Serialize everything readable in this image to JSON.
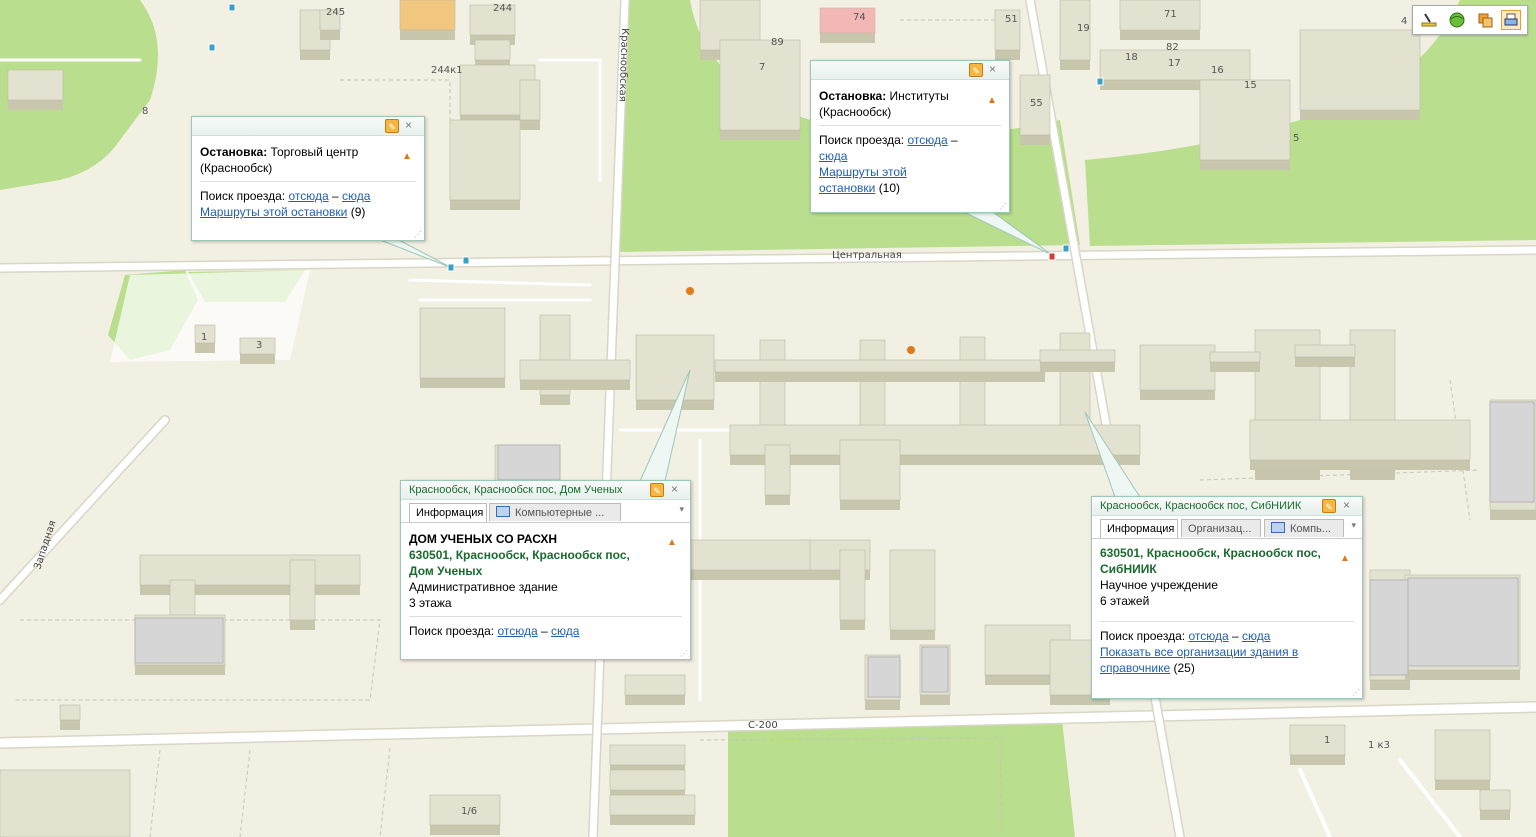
{
  "map": {
    "streets": {
      "central": "Центральная",
      "western": "Западная",
      "krasnoobskaya": "Краснообская",
      "highway": "С-200"
    },
    "building_numbers": [
      "245",
      "244",
      "244к1",
      "8",
      "74",
      "89",
      "7",
      "51",
      "19",
      "71",
      "82",
      "18",
      "17",
      "16",
      "15",
      "4",
      "55",
      "5",
      "1",
      "3",
      "1/6",
      "1",
      "1 к3"
    ]
  },
  "toolbar": {
    "tools": [
      {
        "icon": "ruler-icon",
        "label": ""
      },
      {
        "icon": "globe-icon",
        "label": ""
      },
      {
        "icon": "layers-icon",
        "label": ""
      },
      {
        "icon": "print-icon",
        "label": ""
      }
    ]
  },
  "popups": {
    "stop_trade": {
      "title_label": "Остановка:",
      "title_value": "Торговый центр (Краснообск)",
      "search_label": "Поиск проезда:",
      "from_here": "отсюда",
      "dash": "–",
      "to_here": "сюда",
      "routes_link": "Маршруты этой остановки",
      "routes_count": "(9)"
    },
    "stop_institutes": {
      "title_label": "Остановка:",
      "title_value": "Институты (Краснообск)",
      "search_label": "Поиск проезда:",
      "from_here": "отсюда",
      "dash": "–",
      "to_here": "сюда",
      "routes_link": "Маршруты этой остановки",
      "routes_count": "(10)"
    },
    "scientists_house": {
      "header": "Краснообск, Краснообск пос, Дом Ученых",
      "tabs": [
        "Информация",
        "Компьютерные ..."
      ],
      "name": "ДОМ УЧЕНЫХ СО РАСХН",
      "address": "630501, Краснообск, Краснообск пос, Дом Ученых",
      "type": "Административное здание",
      "floors": "3 этажа",
      "search_label": "Поиск проезда:",
      "from_here": "отсюда",
      "dash": "–",
      "to_here": "сюда"
    },
    "sibniik": {
      "header": "Краснообск, Краснообск пос, СибНИИК",
      "tabs": [
        "Информация",
        "Организац...",
        "Компь..."
      ],
      "address": "630501, Краснообск, Краснообск пос, СибНИИК",
      "type": "Научное учреждение",
      "floors": "6 этажей",
      "search_label": "Поиск проезда:",
      "from_here": "отсюда",
      "dash": "–",
      "to_here": "сюда",
      "orgs_link": "Показать все организации здания в справочнике",
      "orgs_count": "(25)"
    }
  },
  "colors": {
    "background": "#f2efe3",
    "park": "#b9de8e",
    "road": "#ffffff",
    "building_top": "#e3e1cf",
    "building_side": "#c9c6ae",
    "popup_border": "#9cc8b8",
    "link": "#1f5fb0",
    "address_green": "#1a6b2e"
  }
}
